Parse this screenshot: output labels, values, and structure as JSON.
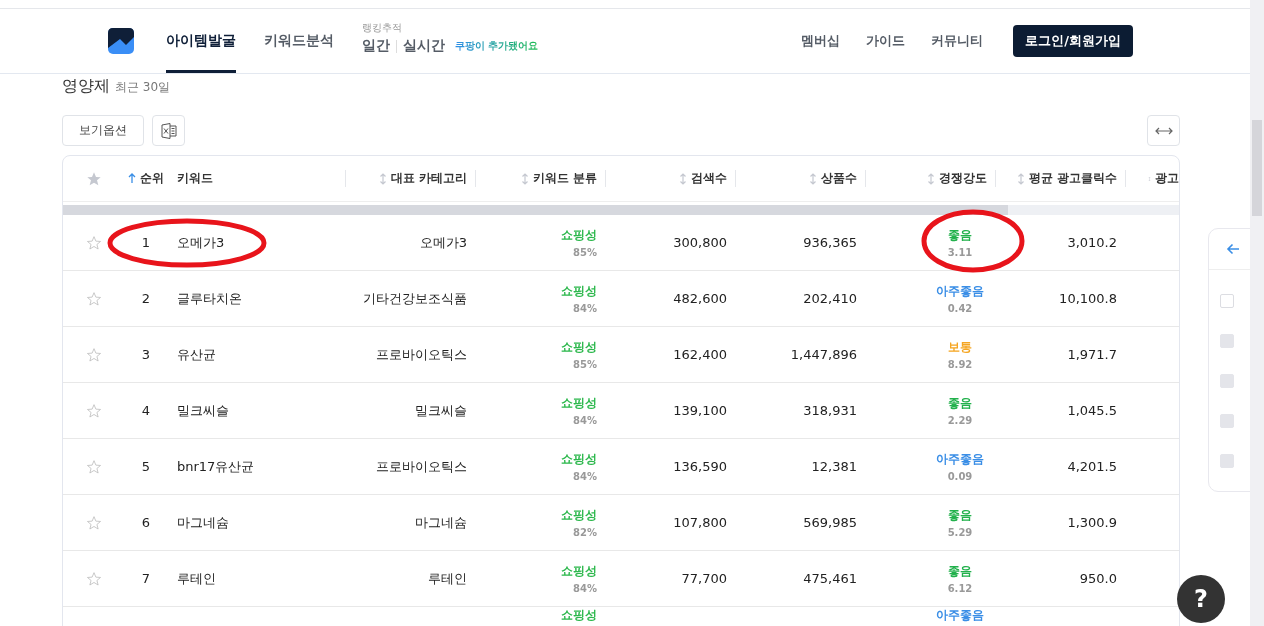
{
  "nav": {
    "items": [
      {
        "label": "아이템발굴",
        "selected": true
      },
      {
        "label": "키워드분석",
        "selected": false
      }
    ],
    "ranking": {
      "caption": "랭킹추적",
      "daily": "일간",
      "realtime": "실시간",
      "notice": "쿠팡이 추가됐어요"
    },
    "right_links": [
      "멤버십",
      "가이드",
      "커뮤니티"
    ],
    "login": "로그인/회원가입"
  },
  "page": {
    "title": "영양제",
    "period": "최근 30일",
    "view_options": "보기옵션"
  },
  "table": {
    "columns": [
      {
        "label": "순위",
        "sortable": true,
        "sorted": true
      },
      {
        "label": "키워드"
      },
      {
        "label": "대표 카테고리",
        "sortable": true,
        "sorted": false
      },
      {
        "label": "키워드 분류",
        "sortable": true,
        "sorted": false
      },
      {
        "label": "검색수",
        "sortable": true,
        "sorted": false
      },
      {
        "label": "상품수",
        "sortable": true,
        "sorted": false
      },
      {
        "label": "경쟁강도",
        "sortable": true,
        "sorted": false
      },
      {
        "label": "평균 광고클릭수",
        "sortable": true,
        "sorted": false
      },
      {
        "label": "광고",
        "sortable": true,
        "sorted": false
      }
    ],
    "rows": [
      {
        "starred": false,
        "rank": "1",
        "keyword": "오메가3",
        "category": "오메가3",
        "class": "쇼핑성",
        "class_pct": "85%",
        "searches": "300,800",
        "products": "936,365",
        "color": "#22b14c",
        "comp": "좋음",
        "comp_score": "3.11",
        "clicks": "3,010.2",
        "circled_keyword": true,
        "circled_comp": true
      },
      {
        "starred": false,
        "rank": "2",
        "keyword": "글루타치온",
        "category": "기타건강보조식품",
        "class": "쇼핑성",
        "class_pct": "84%",
        "searches": "482,600",
        "products": "202,410",
        "color": "#3a8ee6",
        "comp": "아주좋음",
        "comp_score": "0.42",
        "clicks": "10,100.8",
        "circled_keyword": false,
        "circled_comp": false
      },
      {
        "starred": false,
        "rank": "3",
        "keyword": "유산균",
        "category": "프로바이오틱스",
        "class": "쇼핑성",
        "class_pct": "85%",
        "searches": "162,400",
        "products": "1,447,896",
        "color": "#f5a623",
        "comp": "보통",
        "comp_score": "8.92",
        "clicks": "1,971.7",
        "circled_keyword": false,
        "circled_comp": false
      },
      {
        "starred": false,
        "rank": "4",
        "keyword": "밀크씨슬",
        "category": "밀크씨슬",
        "class": "쇼핑성",
        "class_pct": "84%",
        "searches": "139,100",
        "products": "318,931",
        "color": "#22b14c",
        "comp": "좋음",
        "comp_score": "2.29",
        "clicks": "1,045.5",
        "circled_keyword": false,
        "circled_comp": false
      },
      {
        "starred": false,
        "rank": "5",
        "keyword": "bnr17유산균",
        "category": "프로바이오틱스",
        "class": "쇼핑성",
        "class_pct": "84%",
        "searches": "136,590",
        "products": "12,381",
        "color": "#3a8ee6",
        "comp": "아주좋음",
        "comp_score": "0.09",
        "clicks": "4,201.5",
        "circled_keyword": false,
        "circled_comp": false
      },
      {
        "starred": false,
        "rank": "6",
        "keyword": "마그네슘",
        "category": "마그네슘",
        "class": "쇼핑성",
        "class_pct": "82%",
        "searches": "107,800",
        "products": "569,985",
        "color": "#22b14c",
        "comp": "좋음",
        "comp_score": "5.29",
        "clicks": "1,300.9",
        "circled_keyword": false,
        "circled_comp": false
      },
      {
        "starred": false,
        "rank": "7",
        "keyword": "루테인",
        "category": "루테인",
        "class": "쇼핑성",
        "class_pct": "84%",
        "searches": "77,700",
        "products": "475,461",
        "color": "#22b14c",
        "comp": "좋음",
        "comp_score": "6.12",
        "clicks": "950.0",
        "circled_keyword": false,
        "circled_comp": false
      },
      {
        "class": "쇼핑성",
        "color": "#3a8ee6",
        "comp": "아주좋음"
      }
    ]
  },
  "side_panel": {
    "checkboxes": [
      {
        "checked": false,
        "disabled": false
      },
      {
        "checked": false,
        "disabled": true
      },
      {
        "checked": false,
        "disabled": true
      },
      {
        "checked": false,
        "disabled": true
      },
      {
        "checked": false,
        "disabled": true
      }
    ]
  },
  "help": "?"
}
